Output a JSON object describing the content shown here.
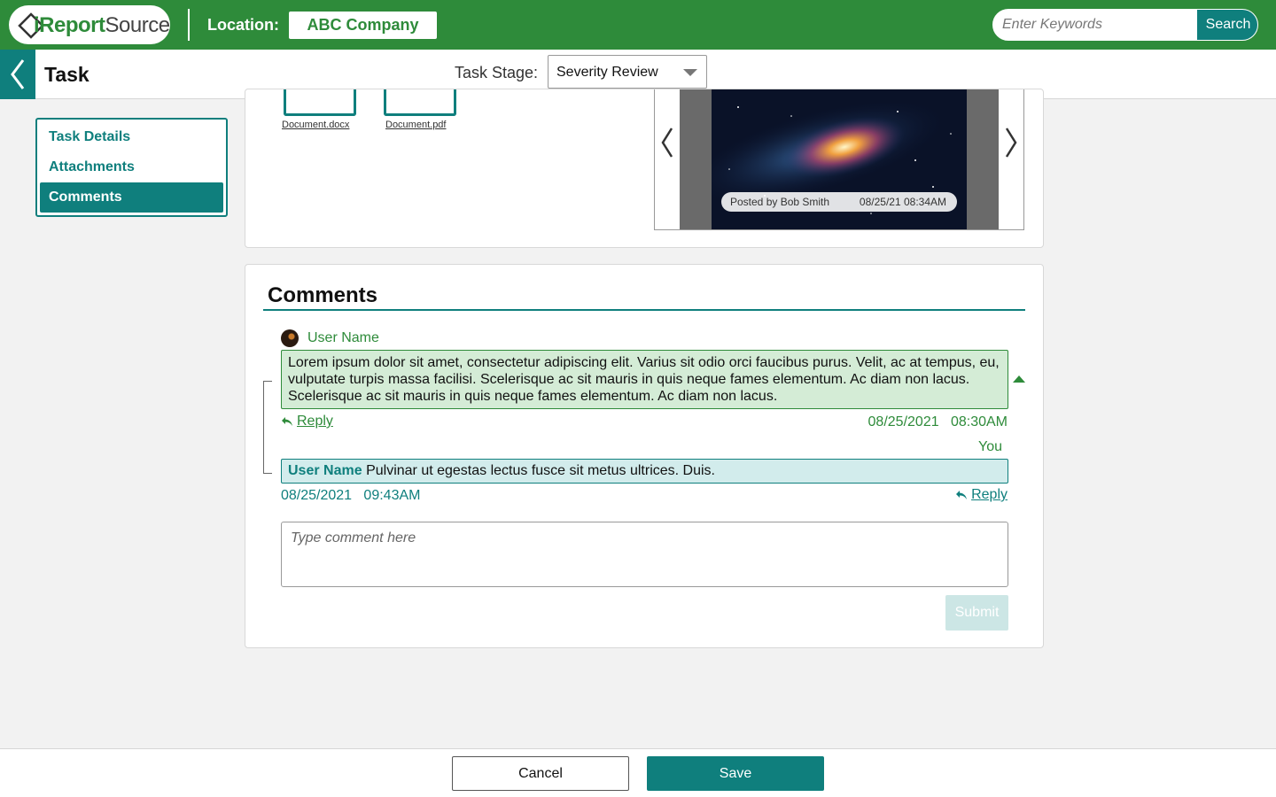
{
  "header": {
    "logo_text_i": "i",
    "logo_text_report": "Report",
    "logo_text_source": "Source",
    "location_label": "Location:",
    "location_value": "ABC Company",
    "search_placeholder": "Enter Keywords",
    "search_button": "Search"
  },
  "subheader": {
    "title": "Task",
    "stage_label": "Task Stage:",
    "stage_value": "Severity Review"
  },
  "sidebar": {
    "items": [
      {
        "label": "Task Details",
        "active": false
      },
      {
        "label": "Attachments",
        "active": false
      },
      {
        "label": "Comments",
        "active": true
      }
    ]
  },
  "attachments": {
    "documents": [
      "Document.docx",
      "Document.pdf"
    ],
    "carousel": {
      "caption_author": "Posted by Bob Smith",
      "caption_date": "08/25/21 08:34AM"
    }
  },
  "comments": {
    "title": "Comments",
    "thread": [
      {
        "user": "User Name",
        "text": "Lorem ipsum dolor sit amet, consectetur adipiscing elit. Varius sit odio orci faucibus purus. Velit, ac at tempus, eu, vulputate turpis massa facilisi. Scelerisque ac sit mauris in quis neque fames elementum. Ac diam non lacus. Scelerisque ac sit mauris in quis neque fames elementum. Ac diam non lacus.",
        "reply_label": "Reply",
        "date": "08/25/2021",
        "time": "08:30AM"
      },
      {
        "by_label": "You",
        "user": "User Name",
        "text": "Pulvinar ut egestas lectus fusce sit metus ultrices. Duis.",
        "reply_label": "Reply",
        "date": "08/25/2021",
        "time": "09:43AM"
      }
    ],
    "input_placeholder": "Type comment here",
    "submit_label": "Submit"
  },
  "footer": {
    "cancel_label": "Cancel",
    "save_label": "Save"
  },
  "colors": {
    "brand_green": "#2e8b3a",
    "teal": "#0f7f7d",
    "comment_green_bg": "#d4ecd6",
    "comment_teal_bg": "#d2ecec"
  }
}
